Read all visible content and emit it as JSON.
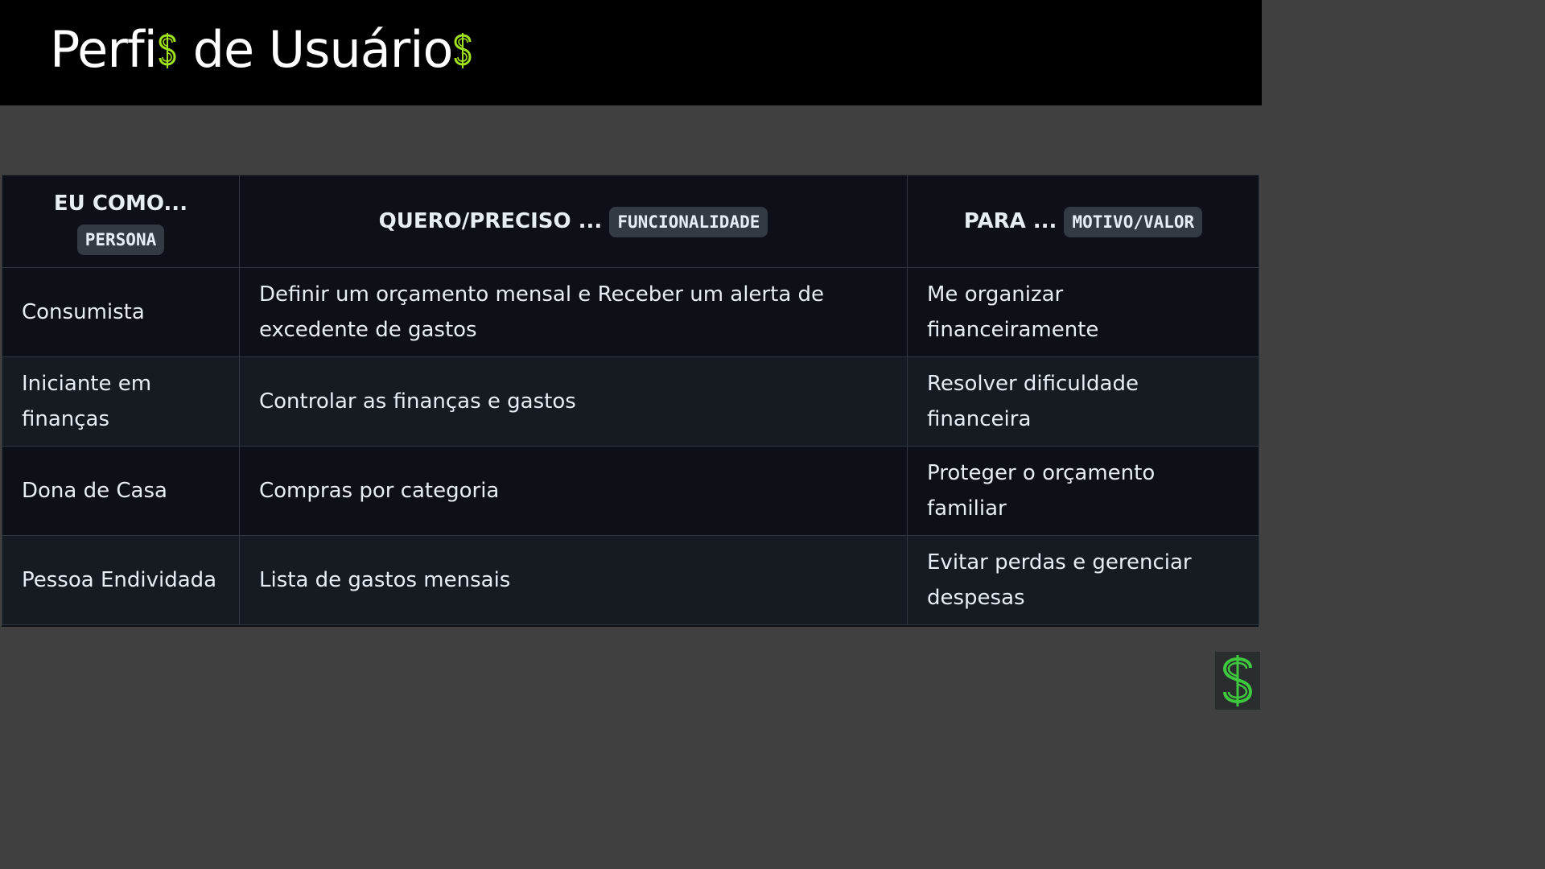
{
  "header": {
    "title_part1": "Perfi",
    "title_part2": " de Usuário",
    "accent_color": "#9fe11a",
    "dollar_icon": "dollar-sign-icon"
  },
  "table": {
    "columns": [
      {
        "label": "EU COMO...",
        "badge": "PERSONA"
      },
      {
        "label": "QUERO/PRECISO ...",
        "badge": "FUNCIONALIDADE"
      },
      {
        "label": "PARA ...",
        "badge": "MOTIVO/VALOR"
      }
    ],
    "rows": [
      [
        "Consumista",
        "Definir um orçamento mensal e Receber um alerta de excedente de gastos",
        "Me organizar financeiramente"
      ],
      [
        "Iniciante em finanças",
        "Controlar as finanças e gastos",
        "Resolver dificuldade financeira"
      ],
      [
        "Dona de Casa",
        "Compras por categoria",
        "Proteger o orçamento familiar"
      ],
      [
        "Pessoa Endividada",
        "Lista de gastos mensais",
        "Evitar perdas e gerenciar despesas"
      ]
    ]
  },
  "logo": {
    "icon": "dollar-sign-icon",
    "color": "#3ec83e"
  }
}
